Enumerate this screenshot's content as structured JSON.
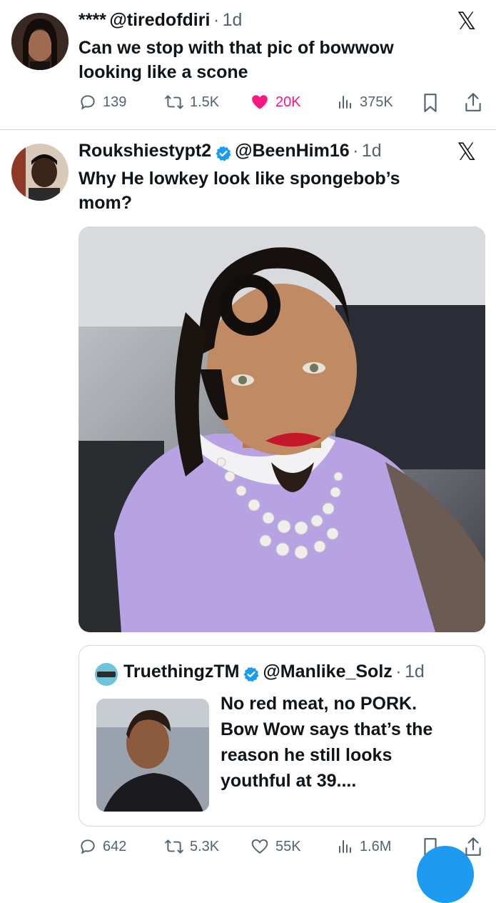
{
  "tweet1": {
    "display_name": "****",
    "handle": "@tiredofdiri",
    "time": "1d",
    "text_line1": "Can we stop with that pic of bowwow",
    "text_line2": "looking like a scone",
    "stats": {
      "replies": "139",
      "reposts": "1.5K",
      "likes": "20K",
      "views": "375K"
    },
    "like_color": "#f91880",
    "x_logo": "𝕏"
  },
  "tweet2": {
    "display_name": "Roukshiestypt2",
    "handle": "@BeenHim16",
    "time": "1d",
    "text_line1": "Why He lowkey look like spongebob’s",
    "text_line2": "mom?",
    "x_logo": "𝕏",
    "quote": {
      "display_name": "TruethingzTM",
      "handle": "@Manlike_Solz",
      "time": "1d",
      "text_lines": [
        "No red meat, no PORK.",
        "Bow Wow says that’s the",
        "reason he still looks",
        "youthful at 39...."
      ]
    },
    "stats": {
      "replies": "642",
      "reposts": "5.3K",
      "likes": "55K",
      "views": "1.6M"
    }
  },
  "colors": {
    "verified": "#1d9bf0",
    "text_secondary": "#536471",
    "border": "#cfd9de"
  }
}
